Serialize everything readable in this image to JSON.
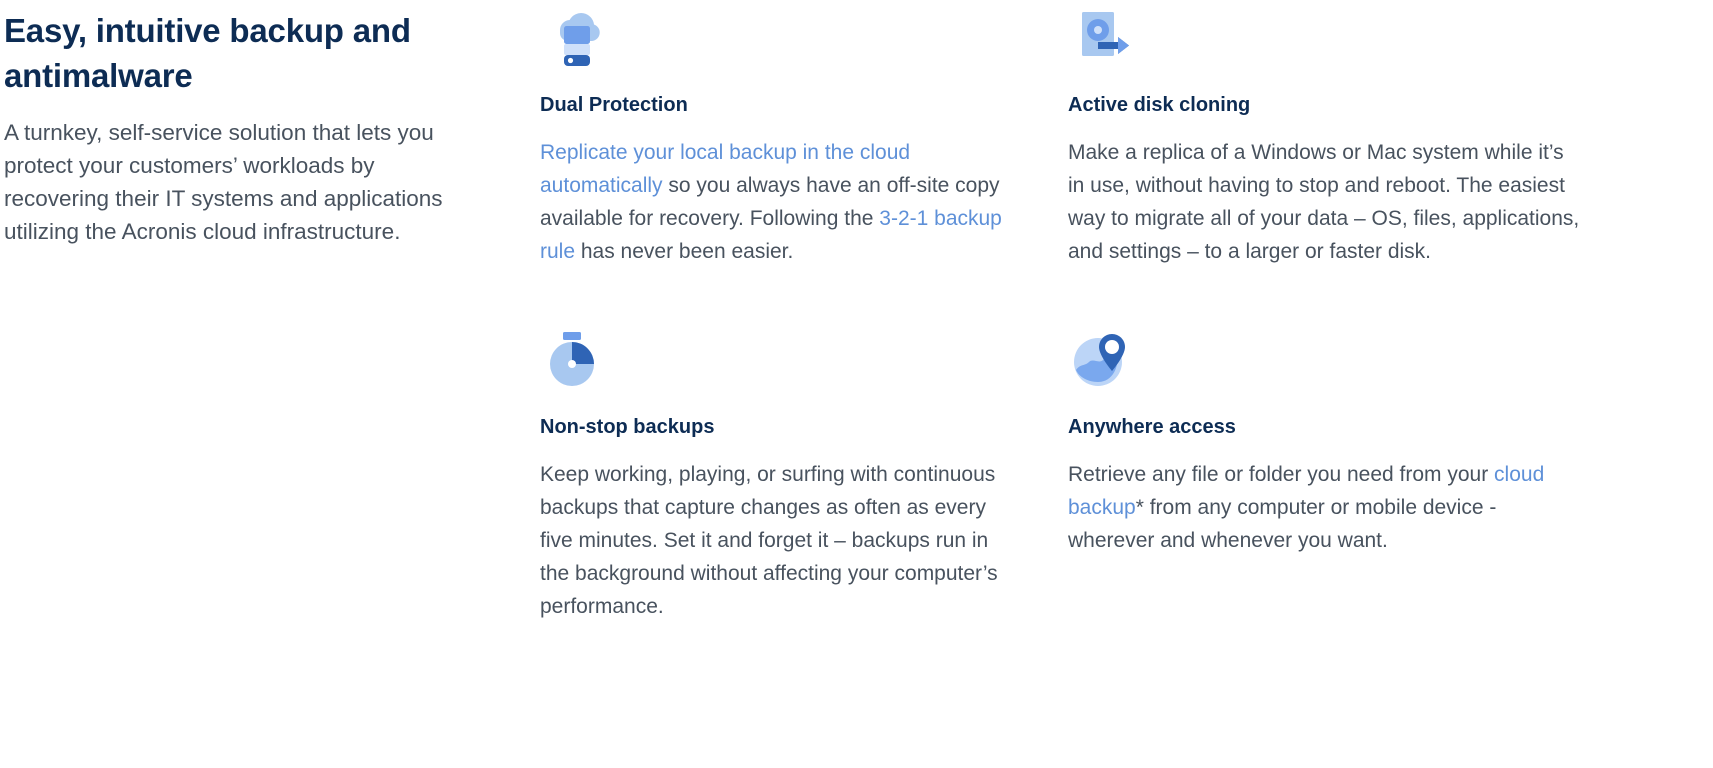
{
  "colors": {
    "heading": "#0d2c54",
    "body_text": "#48525e",
    "link": "#5e90d8",
    "icon_light": "#a8c8f0",
    "icon_mid": "#6f9eea",
    "icon_dark": "#2f64b5",
    "background": "#ffffff"
  },
  "intro": {
    "title": "Easy, intuitive backup and antimalware",
    "body": "A turnkey, self-service solution that lets you protect your customers’ workloads by recovering their IT systems and applications utilizing the Acronis cloud infrastructure."
  },
  "features": [
    {
      "id": "dual-protection",
      "icon": "cloud-server-icon",
      "title": "Dual Protection",
      "body_parts": [
        {
          "type": "link",
          "text": "Replicate your local backup in the cloud automatically"
        },
        {
          "type": "text",
          "text": " so you always have an off-site copy available for recovery. Following the "
        },
        {
          "type": "link",
          "text": "3-2-1 backup rule"
        },
        {
          "type": "text",
          "text": " has never been easier."
        }
      ]
    },
    {
      "id": "active-disk-cloning",
      "icon": "disk-clone-arrow-icon",
      "title": "Active disk cloning",
      "body_parts": [
        {
          "type": "text",
          "text": "Make a replica of a Windows or Mac system while it’s in use, without having to stop and reboot. The easiest way to migrate all of your data – OS, files, applications, and settings – to a larger or faster disk."
        }
      ]
    },
    {
      "id": "non-stop-backups",
      "icon": "stopwatch-icon",
      "title": "Non-stop backups",
      "body_parts": [
        {
          "type": "text",
          "text": "Keep working, playing, or surfing with continuous backups that capture changes as often as every five minutes. Set it and forget it – backups run in the background without affecting your computer’s performance."
        }
      ]
    },
    {
      "id": "anywhere-access",
      "icon": "globe-pin-icon",
      "title": "Anywhere access",
      "body_parts": [
        {
          "type": "text",
          "text": "Retrieve any file or folder you need from your "
        },
        {
          "type": "link",
          "text": "cloud backup"
        },
        {
          "type": "text",
          "text": "* from any computer or mobile device - wherever and whenever you want."
        }
      ]
    }
  ]
}
